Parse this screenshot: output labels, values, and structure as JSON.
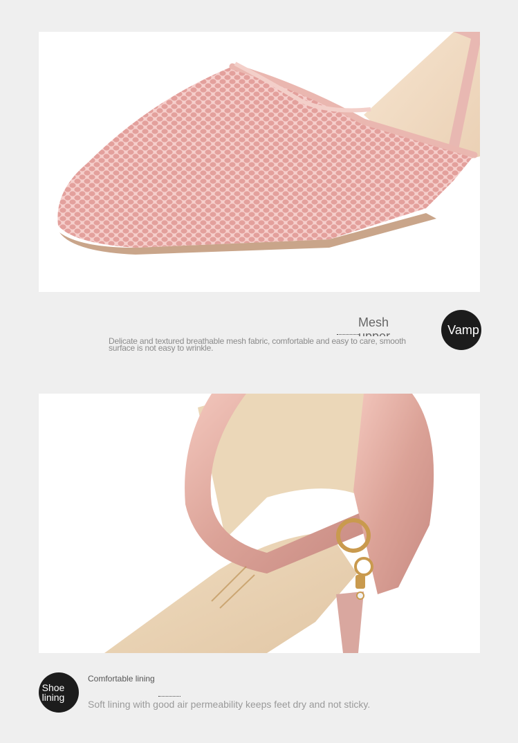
{
  "section1": {
    "title_line1": "Mesh",
    "title_line2": "upper",
    "badge": "Vamp",
    "description": "Delicate and textured breathable mesh fabric, comfortable and easy to care, smooth surface is not easy to wrinkle."
  },
  "section2": {
    "badge_line1": "Shoe",
    "badge_line2": "lining",
    "title": "Comfortable lining",
    "description": "Soft lining with good air permeability keeps feet dry and not sticky."
  },
  "colors": {
    "background": "#efefef",
    "badge": "#1c1c1c",
    "shoe_pink": "#f2c4c4",
    "lining_beige": "#f0dcc0"
  }
}
